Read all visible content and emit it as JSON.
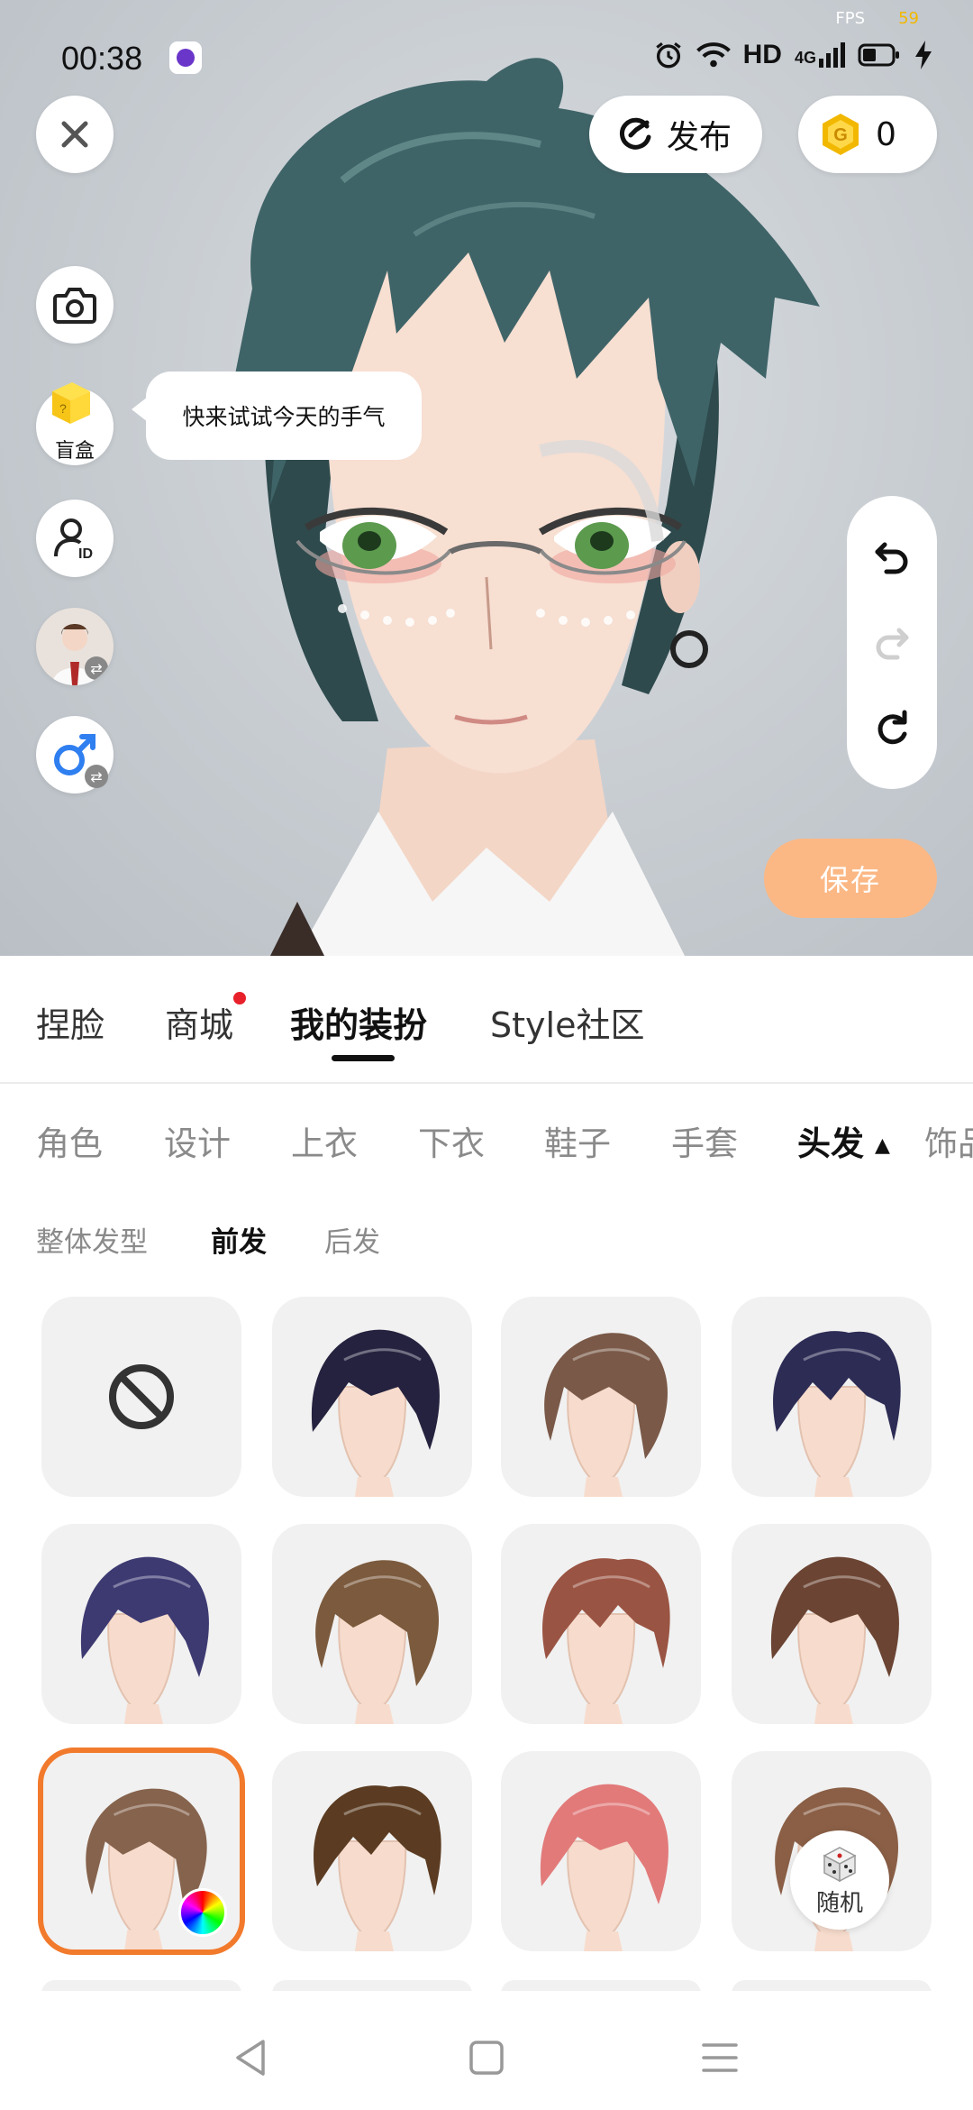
{
  "status_bar": {
    "time": "00:38",
    "network_label": "HD",
    "signal_label": "4G",
    "fps_label": "FPS",
    "fps_value": "59"
  },
  "top_bar": {
    "publish_label": "发布",
    "coin_count": "0"
  },
  "side_toolbar": {
    "blind_box_label": "盲盒",
    "blind_box_tip": "快来试试今天的手气"
  },
  "actions": {
    "save_label": "保存"
  },
  "main_tabs": [
    {
      "label": "捏脸",
      "active": false,
      "badge": false
    },
    {
      "label": "商城",
      "active": false,
      "badge": true
    },
    {
      "label": "我的装扮",
      "active": true,
      "badge": false
    },
    {
      "label": "Style社区",
      "active": false,
      "badge": false
    }
  ],
  "categories": [
    {
      "label": "角色",
      "active": false
    },
    {
      "label": "设计",
      "active": false
    },
    {
      "label": "上衣",
      "active": false
    },
    {
      "label": "下衣",
      "active": false
    },
    {
      "label": "鞋子",
      "active": false
    },
    {
      "label": "手套",
      "active": false
    },
    {
      "label": "头发",
      "active": true
    },
    {
      "label": "饰品",
      "active": false
    }
  ],
  "sub_categories": [
    {
      "label": "整体发型",
      "active": false
    },
    {
      "label": "前发",
      "active": true
    },
    {
      "label": "后发",
      "active": false
    }
  ],
  "hair_items": [
    {
      "id": "none",
      "color": "none",
      "selected": false
    },
    {
      "id": "hair-2",
      "color": "#25223f",
      "selected": false
    },
    {
      "id": "hair-3",
      "color": "#7a5948",
      "selected": false
    },
    {
      "id": "hair-4",
      "color": "#2d2c55",
      "selected": false
    },
    {
      "id": "hair-5",
      "color": "#3d3a72",
      "selected": false
    },
    {
      "id": "hair-6",
      "color": "#7b5a3d",
      "selected": false
    },
    {
      "id": "hair-7",
      "color": "#9a5443",
      "selected": false
    },
    {
      "id": "hair-8",
      "color": "#6b4433",
      "selected": false
    },
    {
      "id": "hair-9",
      "color": "#86634d",
      "selected": true
    },
    {
      "id": "hair-10",
      "color": "#5b3c22",
      "selected": false
    },
    {
      "id": "hair-11",
      "color": "#e27a7a",
      "selected": false
    },
    {
      "id": "hair-12",
      "color": "#8a5f46",
      "selected": false
    }
  ],
  "random_button": {
    "label": "随机"
  },
  "colors": {
    "accent_orange": "#f27a2c",
    "save_button": "#fbb885",
    "avatar_hair": "#3f6468",
    "coin_gold": "#f2b800",
    "badge_red": "#e8202a"
  }
}
